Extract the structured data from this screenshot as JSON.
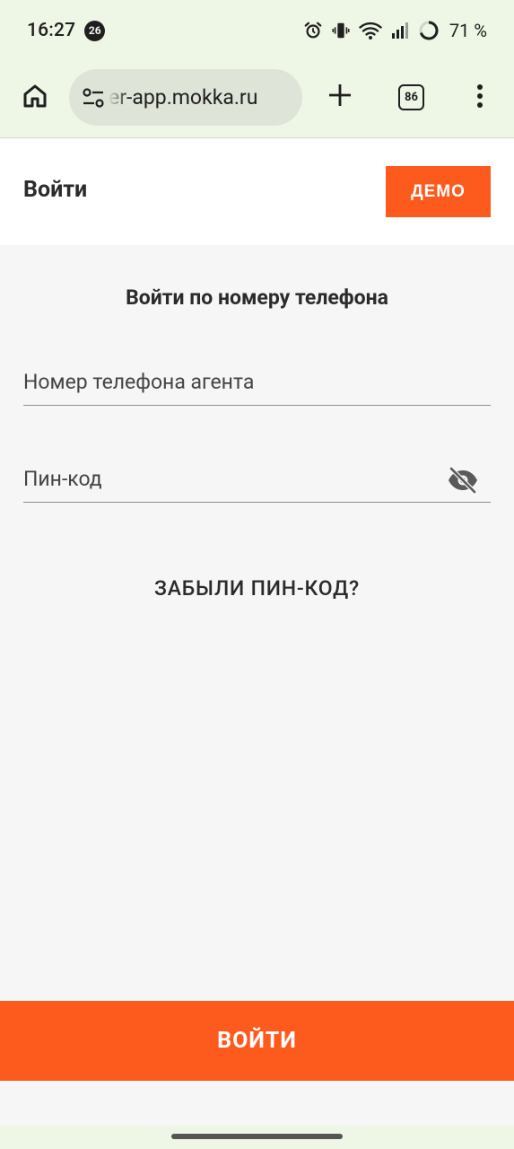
{
  "status_bar": {
    "time": "16:27",
    "notification_count": "26",
    "battery": "71 %"
  },
  "browser": {
    "url": "er-app.mokka.ru",
    "tab_count": "86"
  },
  "header": {
    "title": "Войти",
    "demo_label": "ДЕМО"
  },
  "login": {
    "subtitle": "Войти по номеру телефона",
    "phone_label": "Номер телефона агента",
    "pin_label": "Пин-код",
    "forgot_label": "ЗАБЫЛИ ПИН-КОД?",
    "submit_label": "ВОЙТИ"
  },
  "colors": {
    "accent": "#fd5a1e",
    "chrome_bg": "#eef6e6",
    "page_bg": "#f6f6f6"
  }
}
